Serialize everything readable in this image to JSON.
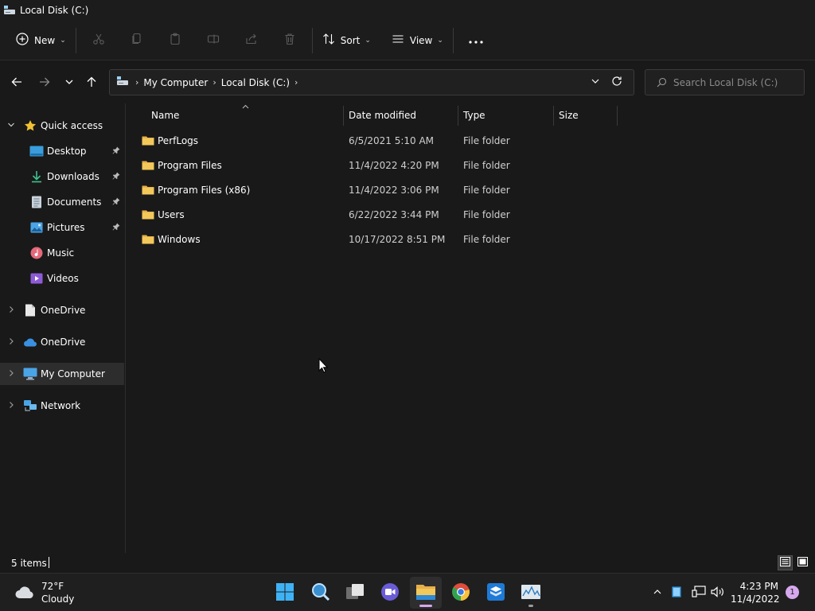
{
  "window": {
    "title": "Local Disk (C:)"
  },
  "commandbar": {
    "new_label": "New",
    "sort_label": "Sort",
    "view_label": "View"
  },
  "address": {
    "crumbs": [
      "My Computer",
      "Local Disk (C:)"
    ],
    "search_placeholder": "Search Local Disk (C:)"
  },
  "sidebar": {
    "quick_access": "Quick access",
    "items": [
      {
        "label": "Desktop",
        "pinned": true
      },
      {
        "label": "Downloads",
        "pinned": true
      },
      {
        "label": "Documents",
        "pinned": true
      },
      {
        "label": "Pictures",
        "pinned": true
      },
      {
        "label": "Music",
        "pinned": false
      },
      {
        "label": "Videos",
        "pinned": false
      }
    ],
    "onedrive_1": "OneDrive",
    "onedrive_2": "OneDrive",
    "my_computer": "My Computer",
    "network": "Network"
  },
  "columns": {
    "name": "Name",
    "date": "Date modified",
    "type": "Type",
    "size": "Size"
  },
  "files": [
    {
      "name": "PerfLogs",
      "date": "6/5/2021 5:10 AM",
      "type": "File folder"
    },
    {
      "name": "Program Files",
      "date": "11/4/2022 4:20 PM",
      "type": "File folder"
    },
    {
      "name": "Program Files (x86)",
      "date": "11/4/2022 3:06 PM",
      "type": "File folder"
    },
    {
      "name": "Users",
      "date": "6/22/2022 3:44 PM",
      "type": "File folder"
    },
    {
      "name": "Windows",
      "date": "10/17/2022 8:51 PM",
      "type": "File folder"
    }
  ],
  "status": {
    "count": "5 items"
  },
  "taskbar": {
    "weather_temp": "72°F",
    "weather_cond": "Cloudy",
    "time": "4:23 PM",
    "date": "11/4/2022",
    "notifications": "1"
  },
  "colors": {
    "folder": "#f3c85a",
    "accent": "#4cc2ff",
    "background": "#191919"
  }
}
